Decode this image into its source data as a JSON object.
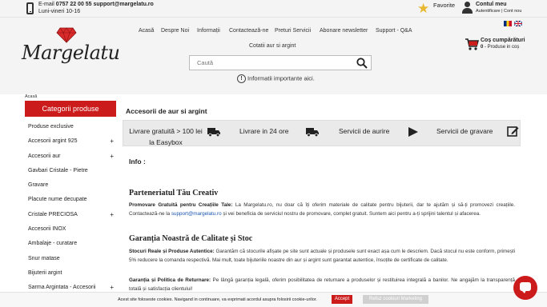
{
  "topbar": {
    "email_label": "E-mail",
    "phone": "0757 22 00 55",
    "email": "support@margelatu.ro",
    "hours": "Luni-vineri 10-16",
    "favorites": "Favorite",
    "account_title": "Contul meu",
    "account_links": "Autentificare | Cont nou"
  },
  "logo": {
    "text": "Margelatu"
  },
  "nav": {
    "items": [
      "Acasă",
      "Despre Noi",
      "Informații",
      "Contactează-ne",
      "Preturi Servicii",
      "Abonare newsletter",
      "Support - Q&A"
    ],
    "second_row": "Cotatii aur si argint"
  },
  "search": {
    "placeholder": "Caută"
  },
  "info_notice": "Informatii importante aici.",
  "cart": {
    "title": "Coș cumpărături",
    "count": "0",
    "subtitle": "- Produse in coș"
  },
  "breadcrumb": "Acasă",
  "sidebar": {
    "title": "Categorii produse",
    "items": [
      {
        "label": "Produse exclusive",
        "plus": ""
      },
      {
        "label": "Accesorii argint 925",
        "plus": "+"
      },
      {
        "label": "Accesorii aur",
        "plus": "+"
      },
      {
        "label": "Gavbari Cristale - Pietre",
        "plus": ""
      },
      {
        "label": "Gravare",
        "plus": ""
      },
      {
        "label": "Placute nume decupate",
        "plus": ""
      },
      {
        "label": "Cristale PRECIOSA",
        "plus": "+"
      },
      {
        "label": "Accesorii INOX",
        "plus": ""
      },
      {
        "label": "Ambalaje - curatare",
        "plus": ""
      },
      {
        "label": "Snur matase",
        "plus": ""
      },
      {
        "label": "Bijuterii argint",
        "plus": ""
      },
      {
        "label": "Sarma Argintata - Accesorii",
        "plus": "+"
      }
    ]
  },
  "main": {
    "title": "Accesorii de aur si argint",
    "features": [
      {
        "line1": "Livrare gratuită > 100 lei",
        "line2": "la Easybox",
        "icon": "truck-icon"
      },
      {
        "line1": "Livrare in 24 ore",
        "line2": "",
        "icon": "truck-icon"
      },
      {
        "line1": "Servicii de aurire",
        "line2": "",
        "icon": "play-icon"
      },
      {
        "line1": "Servicii de gravare",
        "line2": "",
        "icon": "edit-icon"
      }
    ],
    "info_heading": "Info :",
    "section1": {
      "heading": "Parteneriatul Tău Creativ",
      "p1_bold": "Promovare Gratuită pentru Creațiile Tale:",
      "p1_a": " La Margelatu.ro, nu doar că îți oferim materiale de calitate pentru bijuterii, dar te ajutăm și să-ți promovezi creațiile. Contactează-ne la ",
      "p1_link": "support@margelatu.ro",
      "p1_b": " și vei beneficia de serviciul nostru de promovare, complet gratuit. Suntem aici pentru a-ți sprijini talentul și afacerea."
    },
    "section2": {
      "heading": "Garanția Noastră de Calitate și Stoc",
      "p1_bold": "Stocuri Reale și Produse Autentice:",
      "p1": " Garantăm că stocurile afișate pe site sunt actuale și produsele sunt exact așa cum le descriem. Dacă stocul nu este conform, primești 5% reducere la comanda respectivă. Mai mult, toate bijuteriile noastre din aur și argint sunt garantat autentice, însoțite de certificate de calitate.",
      "p2_bold": "Garanția și Politica de Returnare:",
      "p2": " Pe lângă garanția legală, oferim posibilitatea de returnare a produselor și restituirea integrală a banilor. Ne angajăm la transparență totală și satisfacția clientului!"
    }
  },
  "cookie": {
    "text": "Acest site foloseste cookies. Navigand in continuare, va exprimati acordul asupra folosirii cookie-urilor.",
    "accept": "Accept",
    "refuse": "Refuz cookiuri Marketing"
  },
  "colors": {
    "accent": "#cc1b1b",
    "header_bg": "#f4f4f4",
    "link": "#1a55b0"
  }
}
